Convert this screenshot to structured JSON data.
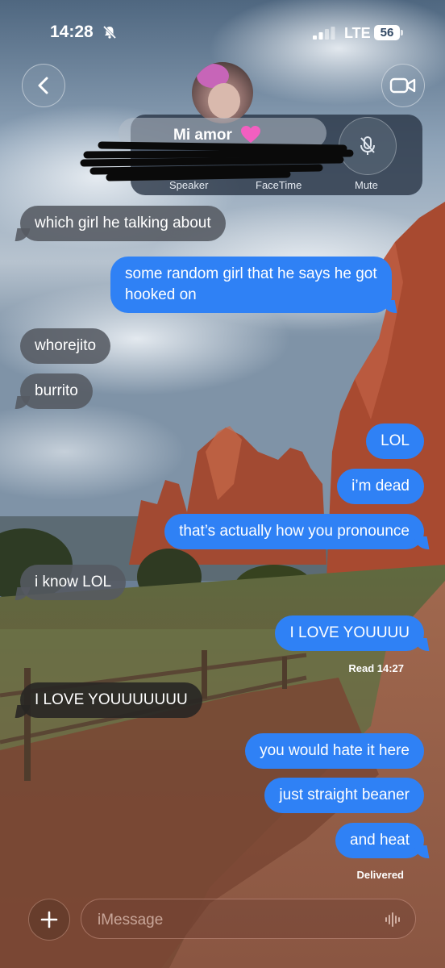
{
  "status_bar": {
    "time": "14:28",
    "network": "LTE",
    "battery": "56",
    "icons": [
      "bell-off-icon",
      "cellular-signal-icon",
      "battery-icon"
    ]
  },
  "header": {
    "contact_name": "Mi amor",
    "name_emoji": "pink-heart-icon",
    "back_icon": "chevron-left-icon",
    "video_icon": "video-camera-icon",
    "call_controls": {
      "speaker": "Speaker",
      "facetime": "FaceTime",
      "mute": "Mute"
    }
  },
  "messages": [
    {
      "dir": "in",
      "text": "which girl he talking about"
    },
    {
      "dir": "out",
      "text": "some random girl that he says he got\nhooked on"
    },
    {
      "dir": "in",
      "text": "whorejito"
    },
    {
      "dir": "in",
      "text": "burrito"
    },
    {
      "dir": "out",
      "text": "LOL"
    },
    {
      "dir": "out",
      "text": "i’m dead"
    },
    {
      "dir": "out",
      "text": "that’s actually how you pronounce"
    },
    {
      "dir": "in",
      "text": "i know LOL"
    },
    {
      "dir": "out",
      "text": "I LOVE YOUUUU"
    },
    {
      "dir": "in",
      "text": "I LOVE YOUUUUUUU"
    },
    {
      "dir": "out",
      "text": "you would hate it here"
    },
    {
      "dir": "out",
      "text": "just straight beaner"
    },
    {
      "dir": "out",
      "text": "and heat"
    }
  ],
  "receipts": {
    "read": "Read 14:27",
    "delivered": "Delivered"
  },
  "composer": {
    "placeholder": "iMessage",
    "plus_icon": "plus-icon",
    "audio_icon": "waveform-icon"
  },
  "colors": {
    "outgoing_bubble": "#2f81f5",
    "incoming_bubble": "#55595f"
  }
}
